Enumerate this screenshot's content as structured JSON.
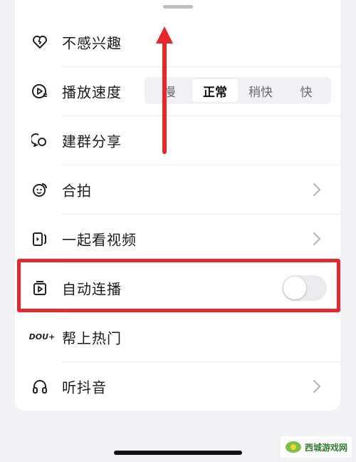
{
  "menu": {
    "not_interested": "不感兴趣",
    "playback_speed": "播放速度",
    "build_group_share": "建群分享",
    "duet": "合拍",
    "watch_together": "一起看视频",
    "autoplay": "自动连播",
    "help_trending": "帮上热门",
    "listen_douyin": "听抖音"
  },
  "speed_options": [
    "慢",
    "正常",
    "稍快",
    "快"
  ],
  "speed_selected": "正常",
  "autoplay_enabled": false,
  "help_trending_icon_text": "DOU+",
  "watermark": "西城游戏网",
  "colors": {
    "highlight": "#e8262b",
    "toggle_off": "#ebebed"
  },
  "icons": {
    "not_interested": "heart-broken-icon",
    "playback_speed": "play-speed-icon",
    "build_group_share": "chat-bubbles-icon",
    "duet": "duet-face-icon",
    "watch_together": "watch-together-icon",
    "autoplay": "autoplay-icon",
    "help_trending": "dou-plus-icon",
    "listen_douyin": "headphones-icon"
  }
}
